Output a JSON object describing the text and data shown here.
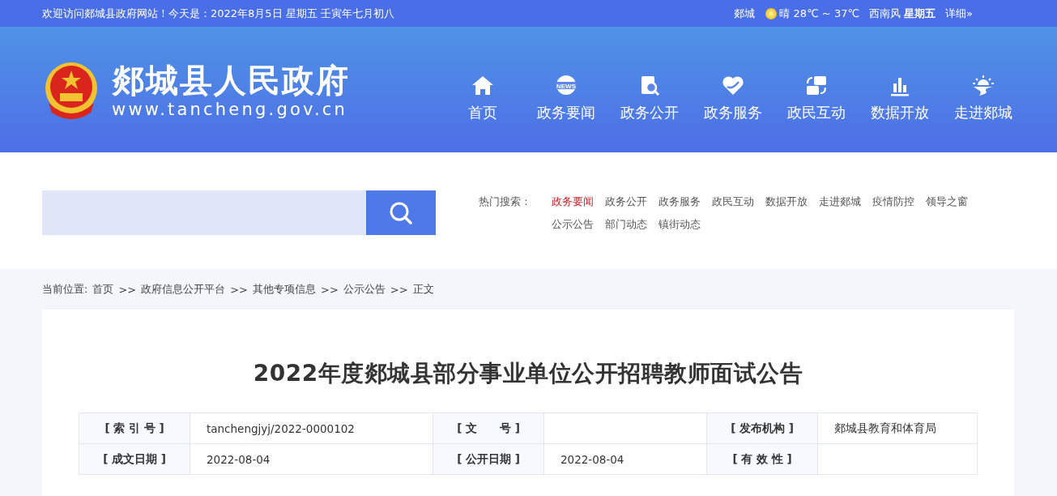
{
  "top_bar": {
    "welcome": "欢迎访问郯城县政府网站！今天是：2022年8月5日  星期五  壬寅年七月初八",
    "weather": {
      "city": "郯城",
      "condition": "晴 28℃ ~ 37℃",
      "wind": "西南风",
      "weekday": "星期五",
      "more": "详细»"
    }
  },
  "header": {
    "site_name": "郯城县人民政府",
    "site_url": "www.tancheng.gov.cn",
    "nav": [
      {
        "label": "首页",
        "kind": "home"
      },
      {
        "label": "政务要闻",
        "kind": "news",
        "icon_text": "NEWS"
      },
      {
        "label": "政务公开",
        "kind": "document"
      },
      {
        "label": "政务服务",
        "kind": "heart"
      },
      {
        "label": "政民互动",
        "kind": "exchange"
      },
      {
        "label": "数据开放",
        "kind": "chart"
      },
      {
        "label": "走进郯城",
        "kind": "sunrise"
      }
    ]
  },
  "search": {
    "hot_label": "热门搜索：",
    "hot_terms": [
      {
        "label": "政务要闻",
        "highlighted": true
      },
      {
        "label": "政务公开",
        "highlighted": false
      },
      {
        "label": "政务服务",
        "highlighted": false
      },
      {
        "label": "政民互动",
        "highlighted": false
      },
      {
        "label": "数据开放",
        "highlighted": false
      },
      {
        "label": "走进郯城",
        "highlighted": false
      },
      {
        "label": "疫情防控",
        "highlighted": false
      },
      {
        "label": "领导之窗",
        "highlighted": false
      },
      {
        "label": "公示公告",
        "highlighted": false
      },
      {
        "label": "部门动态",
        "highlighted": false
      },
      {
        "label": "镇街动态",
        "highlighted": false
      }
    ]
  },
  "breadcrumb": {
    "prefix": "当前位置:",
    "items": [
      "首页",
      "政府信息公开平台",
      "其他专项信息",
      "公示公告",
      "正文"
    ],
    "separator": ">>"
  },
  "article": {
    "title": "2022年度郯城县部分事业单位公开招聘教师面试公告",
    "meta": [
      [
        {
          "label": "[ 索 引 号 ]",
          "value": "tanchengjyj/2022-0000102"
        },
        {
          "label": "[ 文　　号 ]"
        },
        {
          "label": "[ 发布机构 ]",
          "value": "郯城县教育和体育局"
        }
      ],
      [
        {
          "label": "[ 成文日期 ]",
          "value": "2022-08-04"
        },
        {
          "label": "[ 公开日期 ]",
          "value": "2022-08-04"
        },
        {
          "label": "[ 有 效 性 ]"
        }
      ]
    ]
  }
}
